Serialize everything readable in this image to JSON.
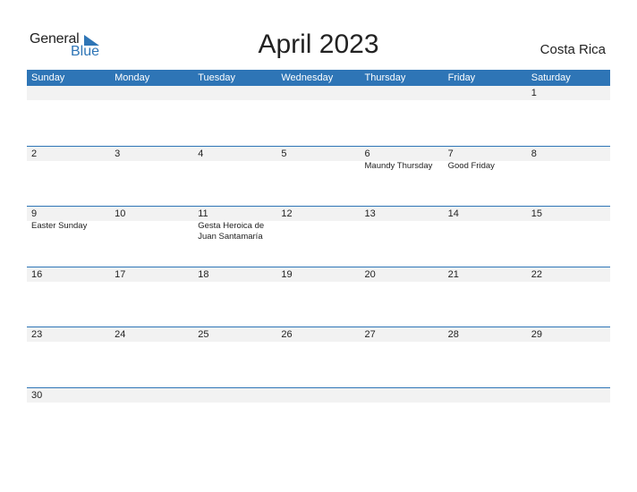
{
  "logo": {
    "word1": "General",
    "word2": "Blue",
    "icon": "triangle-flag-icon"
  },
  "title": "April 2023",
  "country": "Costa Rica",
  "colors": {
    "accent": "#2e75b6",
    "band": "#f2f2f2"
  },
  "weekdays": [
    "Sunday",
    "Monday",
    "Tuesday",
    "Wednesday",
    "Thursday",
    "Friday",
    "Saturday"
  ],
  "weeks": [
    {
      "days": [
        {
          "n": "",
          "h": ""
        },
        {
          "n": "",
          "h": ""
        },
        {
          "n": "",
          "h": ""
        },
        {
          "n": "",
          "h": ""
        },
        {
          "n": "",
          "h": ""
        },
        {
          "n": "",
          "h": ""
        },
        {
          "n": "1",
          "h": ""
        }
      ]
    },
    {
      "days": [
        {
          "n": "2",
          "h": ""
        },
        {
          "n": "3",
          "h": ""
        },
        {
          "n": "4",
          "h": ""
        },
        {
          "n": "5",
          "h": ""
        },
        {
          "n": "6",
          "h": "Maundy Thursday"
        },
        {
          "n": "7",
          "h": "Good Friday"
        },
        {
          "n": "8",
          "h": ""
        }
      ]
    },
    {
      "days": [
        {
          "n": "9",
          "h": "Easter Sunday"
        },
        {
          "n": "10",
          "h": ""
        },
        {
          "n": "11",
          "h": "Gesta Heroica de Juan Santamaría"
        },
        {
          "n": "12",
          "h": ""
        },
        {
          "n": "13",
          "h": ""
        },
        {
          "n": "14",
          "h": ""
        },
        {
          "n": "15",
          "h": ""
        }
      ]
    },
    {
      "days": [
        {
          "n": "16",
          "h": ""
        },
        {
          "n": "17",
          "h": ""
        },
        {
          "n": "18",
          "h": ""
        },
        {
          "n": "19",
          "h": ""
        },
        {
          "n": "20",
          "h": ""
        },
        {
          "n": "21",
          "h": ""
        },
        {
          "n": "22",
          "h": ""
        }
      ]
    },
    {
      "days": [
        {
          "n": "23",
          "h": ""
        },
        {
          "n": "24",
          "h": ""
        },
        {
          "n": "25",
          "h": ""
        },
        {
          "n": "26",
          "h": ""
        },
        {
          "n": "27",
          "h": ""
        },
        {
          "n": "28",
          "h": ""
        },
        {
          "n": "29",
          "h": ""
        }
      ]
    },
    {
      "days": [
        {
          "n": "30",
          "h": ""
        },
        {
          "n": "",
          "h": ""
        },
        {
          "n": "",
          "h": ""
        },
        {
          "n": "",
          "h": ""
        },
        {
          "n": "",
          "h": ""
        },
        {
          "n": "",
          "h": ""
        },
        {
          "n": "",
          "h": ""
        }
      ]
    }
  ]
}
